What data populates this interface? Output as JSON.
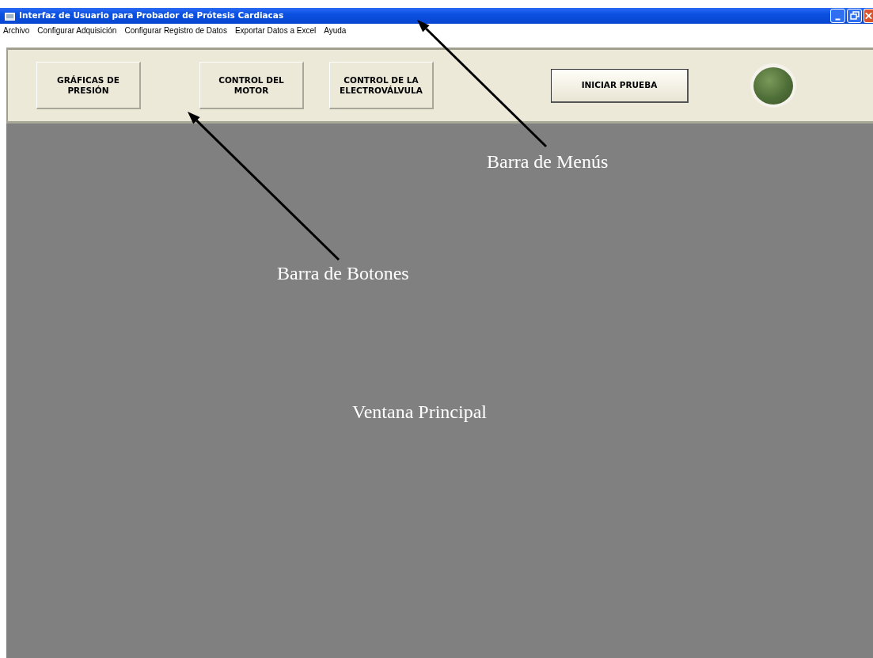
{
  "window": {
    "title": "Interfaz de Usuario para Probador de Prótesis Cardiacas"
  },
  "menu": [
    "Archivo",
    "Configurar Adquisición",
    "Configurar Registro de Datos",
    "Exportar Datos a Excel",
    "Ayuda"
  ],
  "toolbar": {
    "buttons": [
      {
        "label": "GRÁFICAS DE PRESIÓN",
        "kind": "flat"
      },
      {
        "label": "CONTROL DEL MOTOR",
        "kind": "flat"
      },
      {
        "label": "CONTROL DE LA ELECTROVÁLVULA",
        "kind": "flat"
      },
      {
        "label": "INICIAR PRUEBA",
        "kind": "raised"
      }
    ],
    "indicator": {
      "on": true
    }
  },
  "annotations": [
    {
      "text": "Barra de Menús",
      "arrow": true
    },
    {
      "text": "Barra de Botones",
      "arrow": true
    },
    {
      "text": "Ventana Principal",
      "arrow": false
    }
  ]
}
